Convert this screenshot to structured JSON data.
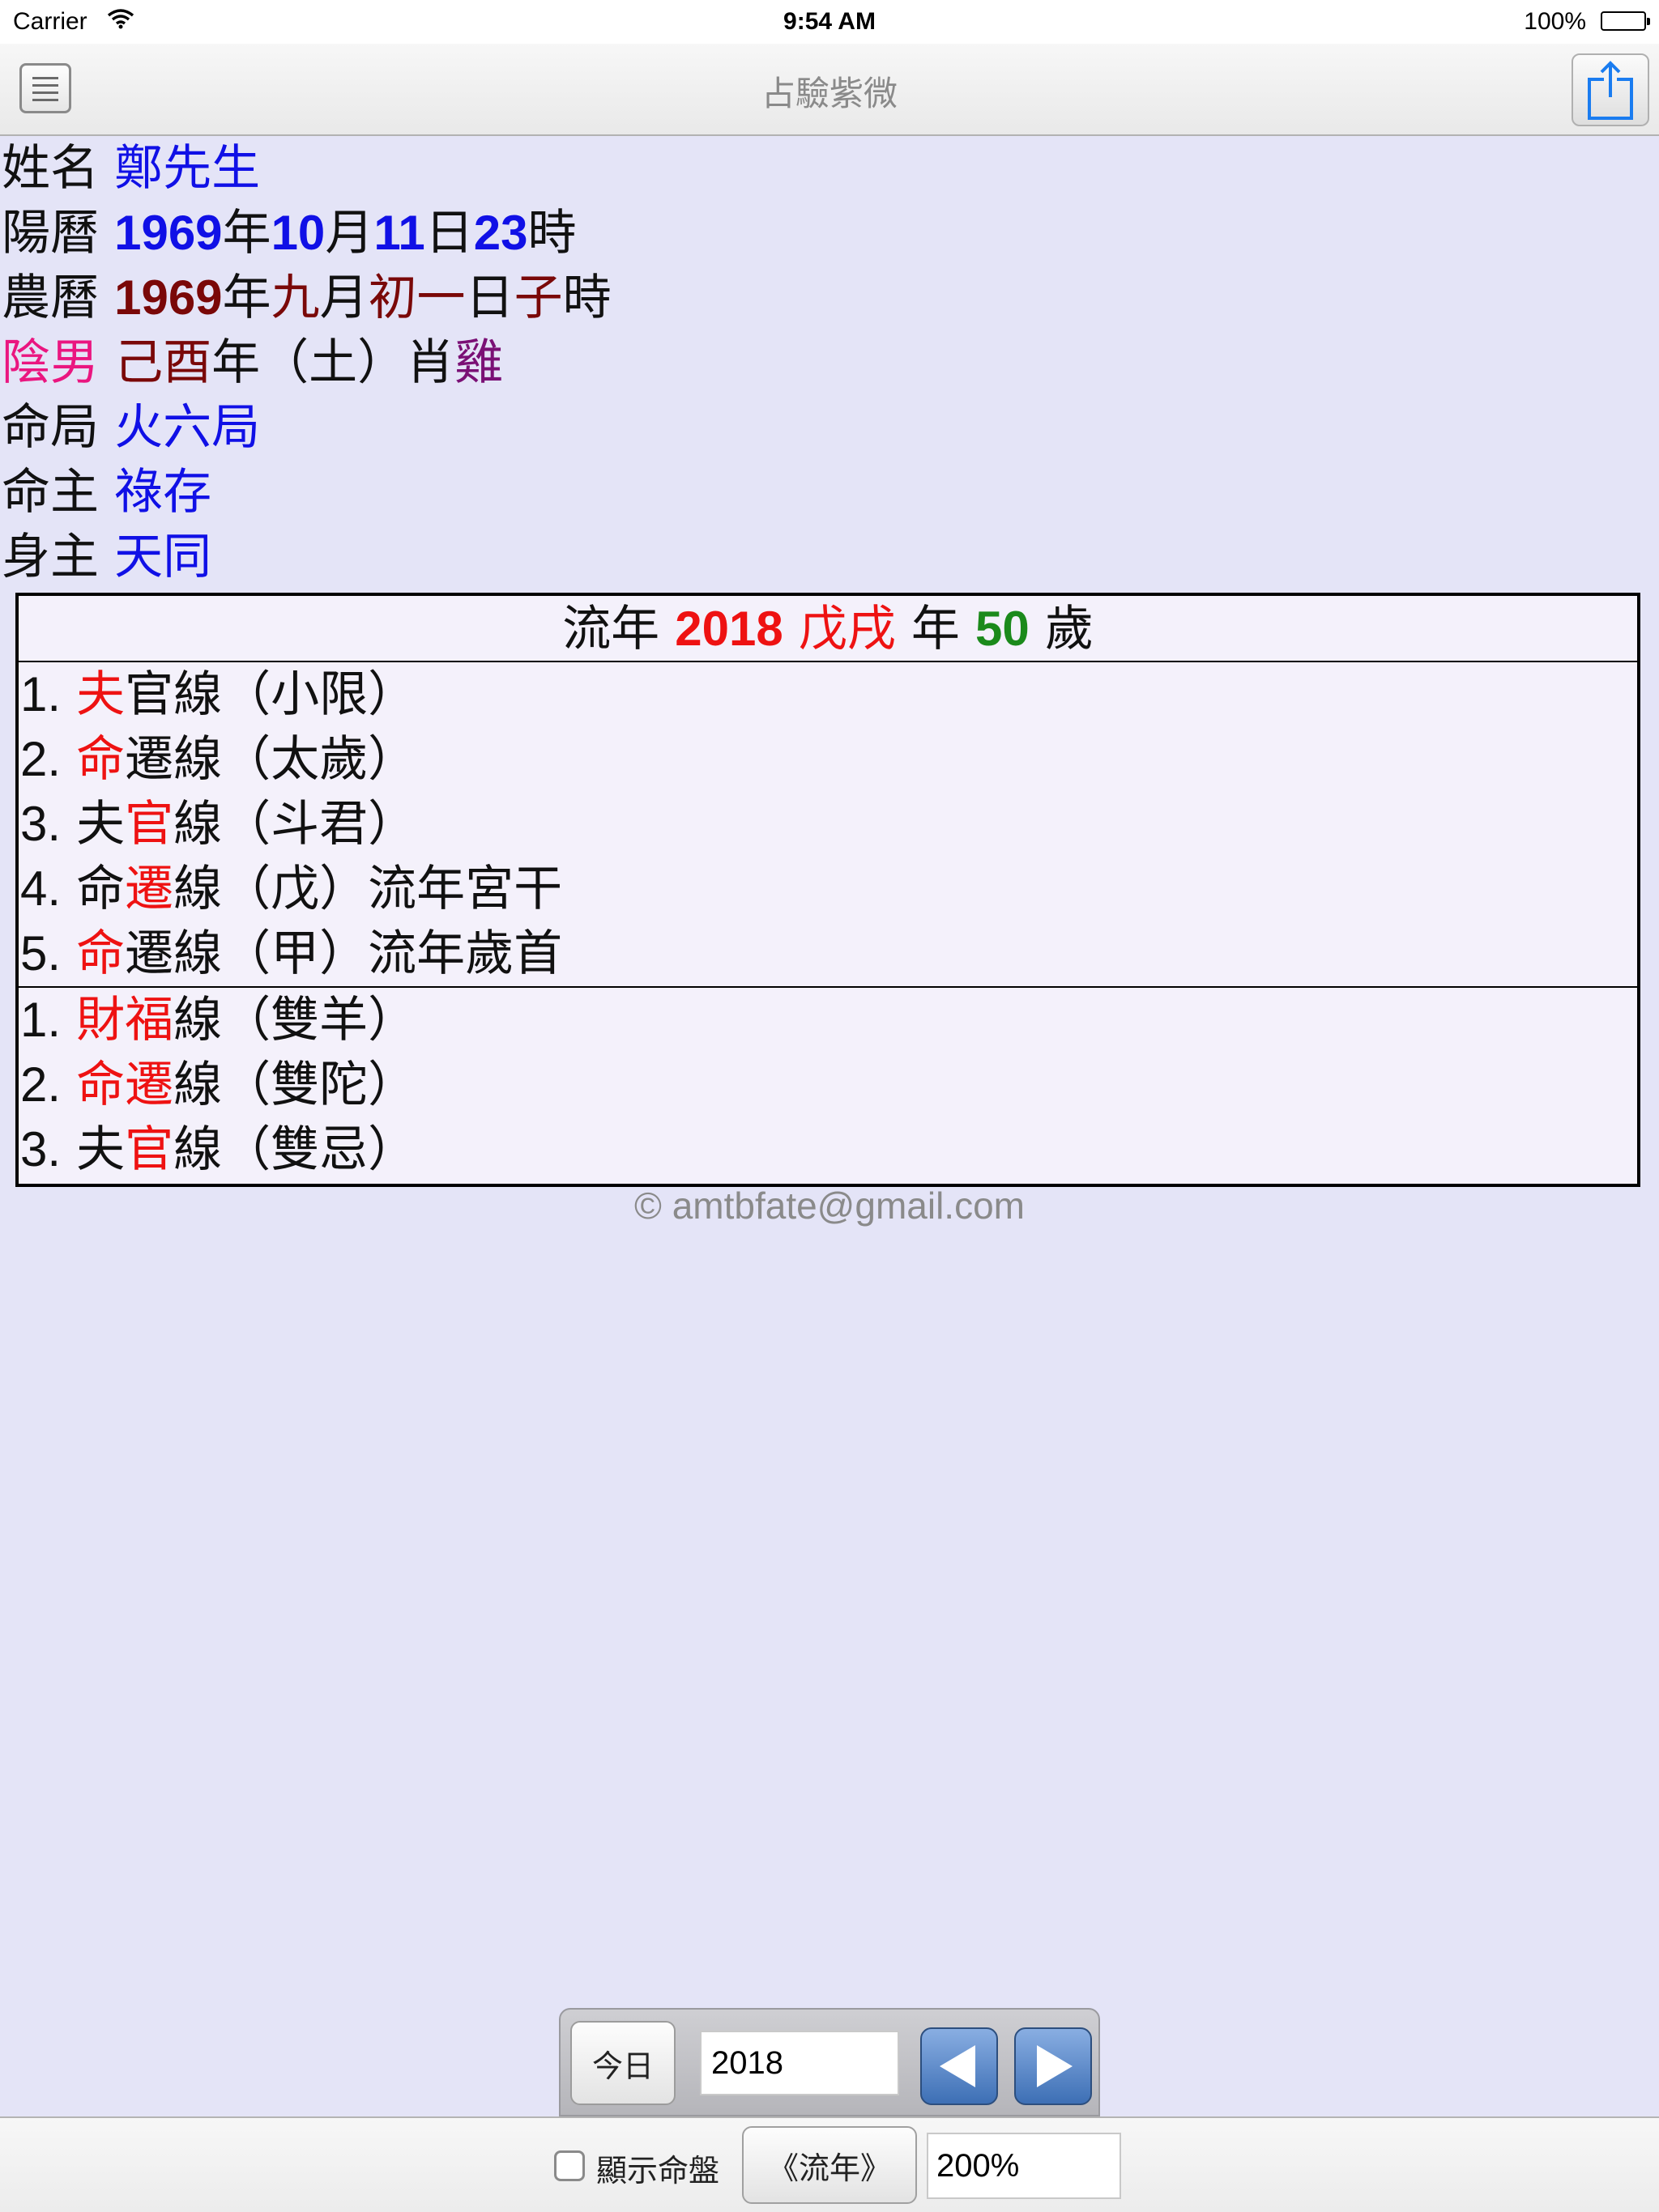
{
  "status": {
    "carrier": "Carrier",
    "time": "9:54 AM",
    "battery": "100%"
  },
  "nav": {
    "title": "占驗紫微"
  },
  "info": {
    "name_label": "姓名",
    "name_value": "鄭先生",
    "solar_label": "陽曆",
    "solar_year": "1969",
    "solar_month": "10",
    "solar_day": "11",
    "solar_hour": "23",
    "u_year": "年",
    "u_month": "月",
    "u_day": "日",
    "u_hour": "時",
    "lunar_label": "農曆",
    "lunar_year": "1969",
    "lunar_month": "九",
    "lunar_day": "初一",
    "lunar_hour": "子",
    "yinyang": "陰男",
    "ganzhi": "己酉",
    "nian_text": "年（土）肖",
    "zodiac": "雞",
    "ju_label": "命局",
    "ju_value": "火六局",
    "mingzhu_label": "命主",
    "mingzhu_value": "祿存",
    "shenzhu_label": "身主",
    "shenzhu_value": "天同"
  },
  "flow": {
    "liunian": "流年",
    "year": "2018",
    "gz": "戊戌",
    "nian": "年",
    "age": "50",
    "sui": "歲",
    "section1": [
      {
        "idx": "1.",
        "hl": "夫",
        "a": "",
        "b": "官",
        "tail": "線（小限）"
      },
      {
        "idx": "2.",
        "hl": "命",
        "a": "",
        "b": "遷",
        "tail": "線（太歲）"
      },
      {
        "idx": "3.",
        "hl": "官",
        "a": "夫",
        "b": "",
        "tail": "線（斗君）"
      },
      {
        "idx": "4.",
        "hl": "遷",
        "a": "命",
        "b": "",
        "tail": "線（戊）流年宮干"
      },
      {
        "idx": "5.",
        "hl": "命",
        "a": "",
        "b": "遷",
        "tail": "線（甲）流年歲首"
      }
    ],
    "section2": [
      {
        "idx": "1.",
        "hl": "財福",
        "a": "",
        "b": "",
        "tail": "線（雙羊）"
      },
      {
        "idx": "2.",
        "hl": "命遷",
        "a": "",
        "b": "",
        "tail": "線（雙陀）"
      },
      {
        "idx": "3.",
        "hl": "官",
        "a": "夫",
        "b": "",
        "tail": "線（雙忌）"
      }
    ]
  },
  "copyright": "© amtbfate@gmail.com",
  "controls": {
    "today": "今日",
    "year_input": "2018"
  },
  "toolbar": {
    "show_chart": "顯示命盤",
    "liunian_btn": "《流年》",
    "zoom": "200%"
  }
}
